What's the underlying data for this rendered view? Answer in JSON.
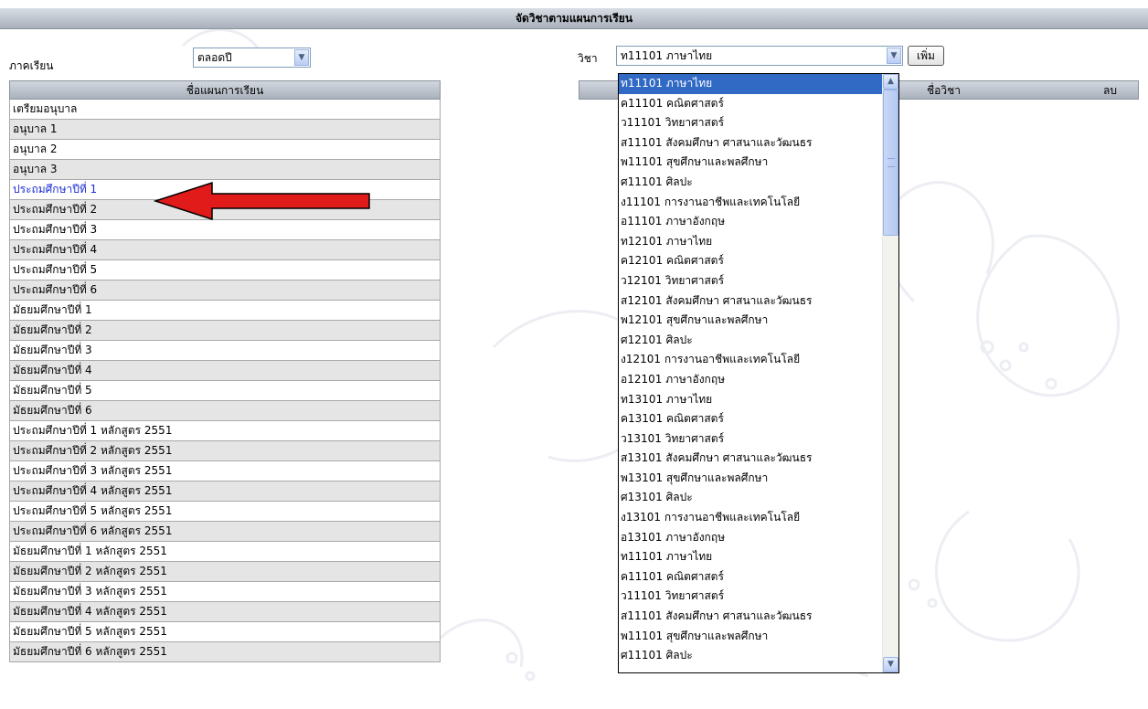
{
  "page_title": "จัดวิชาตามแผนการเรียน",
  "term": {
    "label": "ภาคเรียน",
    "value": "ตลอดปี"
  },
  "subject": {
    "label": "วิชา",
    "value": "ท11101 ภาษาไทย",
    "add_label": "เพิ่ม"
  },
  "plan_table": {
    "header": "ชื่อแผนการเรียน",
    "rows": [
      "เตรียมอนุบาล",
      "อนุบาล 1",
      "อนุบาล 2",
      "อนุบาล 3",
      "ประถมศึกษาปีที่ 1",
      "ประถมศึกษาปีที่ 2",
      "ประถมศึกษาปีที่ 3",
      "ประถมศึกษาปีที่ 4",
      "ประถมศึกษาปีที่ 5",
      "ประถมศึกษาปีที่ 6",
      "มัธยมศึกษาปีที่ 1",
      "มัธยมศึกษาปีที่ 2",
      "มัธยมศึกษาปีที่ 3",
      "มัธยมศึกษาปีที่ 4",
      "มัธยมศึกษาปีที่ 5",
      "มัธยมศึกษาปีที่ 6",
      "ประถมศึกษาปีที่ 1 หลักสูตร 2551",
      "ประถมศึกษาปีที่ 2 หลักสูตร 2551",
      "ประถมศึกษาปีที่ 3 หลักสูตร 2551",
      "ประถมศึกษาปีที่ 4 หลักสูตร 2551",
      "ประถมศึกษาปีที่ 5 หลักสูตร 2551",
      "ประถมศึกษาปีที่ 6 หลักสูตร 2551",
      "มัธยมศึกษาปีที่ 1 หลักสูตร 2551",
      "มัธยมศึกษาปีที่ 2 หลักสูตร 2551",
      "มัธยมศึกษาปีที่ 3 หลักสูตร 2551",
      "มัธยมศึกษาปีที่ 4 หลักสูตร 2551",
      "มัธยมศึกษาปีที่ 5 หลักสูตร 2551",
      "มัธยมศึกษาปีที่ 6 หลักสูตร 2551"
    ],
    "selected_index": 4
  },
  "subject_table": {
    "col_name": "ชื่อวิชา",
    "col_delete": "ลบ"
  },
  "subject_options": [
    "ท11101 ภาษาไทย",
    "ค11101 คณิตศาสตร์",
    "ว11101 วิทยาศาสตร์",
    "ส11101 สังคมศึกษา ศาสนาและวัฒนธร",
    "พ11101 สุขศึกษาและพลศึกษา",
    "ศ11101 ศิลปะ",
    "ง11101 การงานอาชีพและเทคโนโลยี",
    "อ11101 ภาษาอังกฤษ",
    "ท12101 ภาษาไทย",
    "ค12101 คณิตศาสตร์",
    "ว12101 วิทยาศาสตร์",
    "ส12101 สังคมศึกษา ศาสนาและวัฒนธร",
    "พ12101 สุขศึกษาและพลศึกษา",
    "ศ12101 ศิลปะ",
    "ง12101 การงานอาชีพและเทคโนโลยี",
    "อ12101 ภาษาอังกฤษ",
    "ท13101 ภาษาไทย",
    "ค13101 คณิตศาสตร์",
    "ว13101 วิทยาศาสตร์",
    "ส13101 สังคมศึกษา ศาสนาและวัฒนธร",
    "พ13101 สุขศึกษาและพลศึกษา",
    "ศ13101 ศิลปะ",
    "ง13101 การงานอาชีพและเทคโนโลยี",
    "อ13101 ภาษาอังกฤษ",
    "ท11101 ภาษาไทย",
    "ค11101 คณิตศาสตร์",
    "ว11101 วิทยาศาสตร์",
    "ส11101 สังคมศึกษา ศาสนาและวัฒนธร",
    "พ11101 สุขศึกษาและพลศึกษา",
    "ศ11101 ศิลปะ"
  ],
  "highlighted_option_index": 0,
  "colors": {
    "highlight": "#316ac5",
    "selected_text": "#1c2fd6",
    "arrow": "#e11a1a"
  },
  "icons": {
    "dropdown": "chevron-down-icon",
    "annotation": "red-arrow-icon"
  }
}
